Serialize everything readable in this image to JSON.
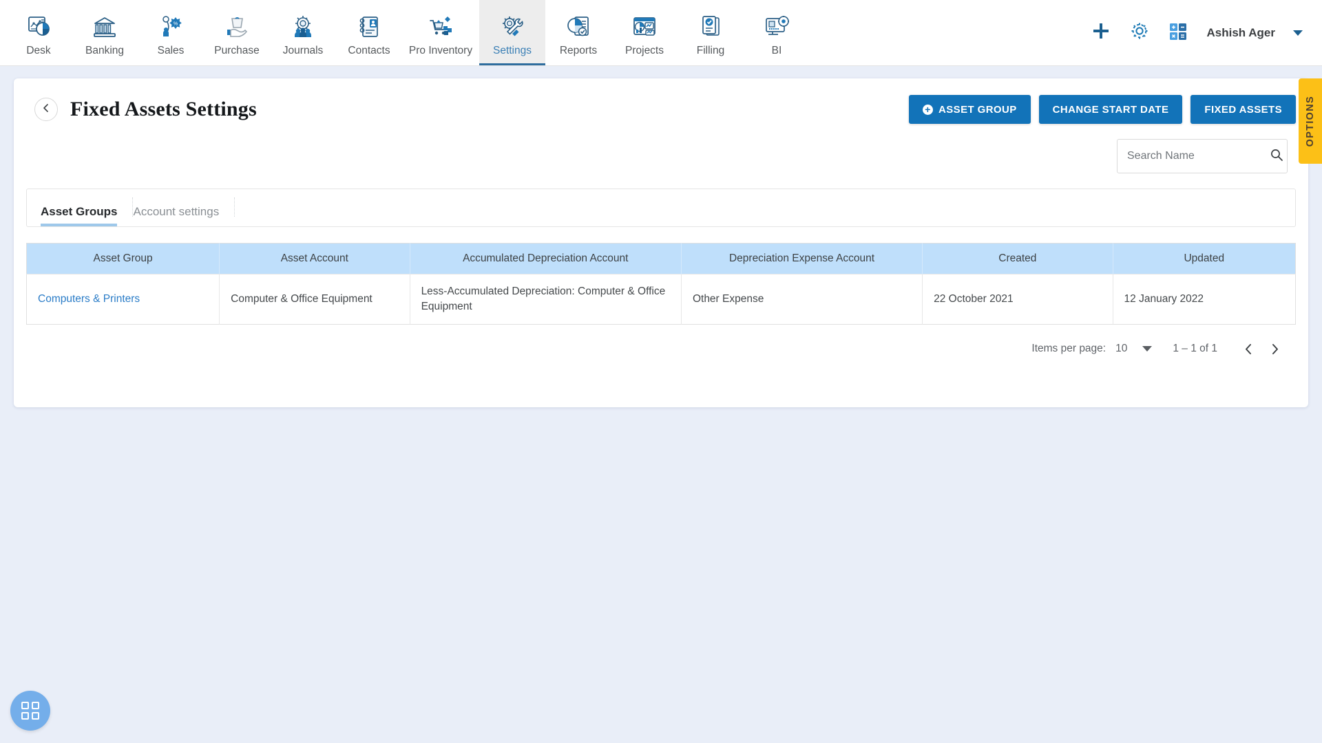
{
  "nav": {
    "items": [
      {
        "label": "Desk",
        "icon": "dashboard-icon",
        "active": false
      },
      {
        "label": "Banking",
        "icon": "bank-icon",
        "active": false
      },
      {
        "label": "Sales",
        "icon": "sales-icon",
        "active": false
      },
      {
        "label": "Purchase",
        "icon": "purchase-icon",
        "active": false
      },
      {
        "label": "Journals",
        "icon": "journals-icon",
        "active": false
      },
      {
        "label": "Contacts",
        "icon": "contacts-icon",
        "active": false
      },
      {
        "label": "Pro Inventory",
        "icon": "inventory-icon",
        "active": false
      },
      {
        "label": "Settings",
        "icon": "settings-tools-icon",
        "active": true
      },
      {
        "label": "Reports",
        "icon": "reports-icon",
        "active": false
      },
      {
        "label": "Projects",
        "icon": "projects-icon",
        "active": false
      },
      {
        "label": "Filling",
        "icon": "filling-icon",
        "active": false
      },
      {
        "label": "BI",
        "icon": "bi-icon",
        "active": false
      }
    ],
    "right": {
      "add_icon": "plus-icon",
      "settings_icon": "gear-icon",
      "calculator_icon": "calculator-icon",
      "user_name": "Ashish Ager",
      "user_menu_icon": "chevron-down-icon"
    }
  },
  "header": {
    "back_icon": "chevron-left-icon",
    "title": "Fixed Assets Settings",
    "buttons": [
      {
        "label": "ASSET GROUP",
        "icon": "plus-circle-icon"
      },
      {
        "label": "CHANGE START DATE",
        "icon": ""
      },
      {
        "label": "FIXED ASSETS",
        "icon": ""
      }
    ]
  },
  "options_tab": {
    "label": "OPTIONS"
  },
  "search": {
    "placeholder": "Search Name",
    "value": "",
    "icon": "search-icon"
  },
  "tabs": [
    {
      "label": "Asset Groups",
      "active": true
    },
    {
      "label": "Account settings",
      "active": false
    }
  ],
  "table": {
    "columns": [
      "Asset Group",
      "Asset Account",
      "Accumulated Depreciation Account",
      "Depreciation Expense Account",
      "Created",
      "Updated"
    ],
    "rows": [
      {
        "asset_group": "Computers & Printers",
        "asset_account": "Computer & Office Equipment",
        "accumulated_depreciation_account": "Less-Accumulated Depreciation: Computer & Office Equipment",
        "depreciation_expense_account": "Other Expense",
        "created": "22 October 2021",
        "updated": "12 January 2022"
      }
    ]
  },
  "paginator": {
    "items_per_page_label": "Items per page:",
    "items_per_page_value": "10",
    "range_label": "1 – 1 of 1",
    "prev_icon": "chevron-left-icon",
    "next_icon": "chevron-right-icon"
  },
  "fab": {
    "icon": "apps-grid-icon"
  },
  "colors": {
    "accent_blue": "#1273b9",
    "link_blue": "#2a7cc7",
    "table_header_blue": "#bfdffb",
    "options_yellow": "#fcc017",
    "page_bg": "#e9eef8"
  }
}
